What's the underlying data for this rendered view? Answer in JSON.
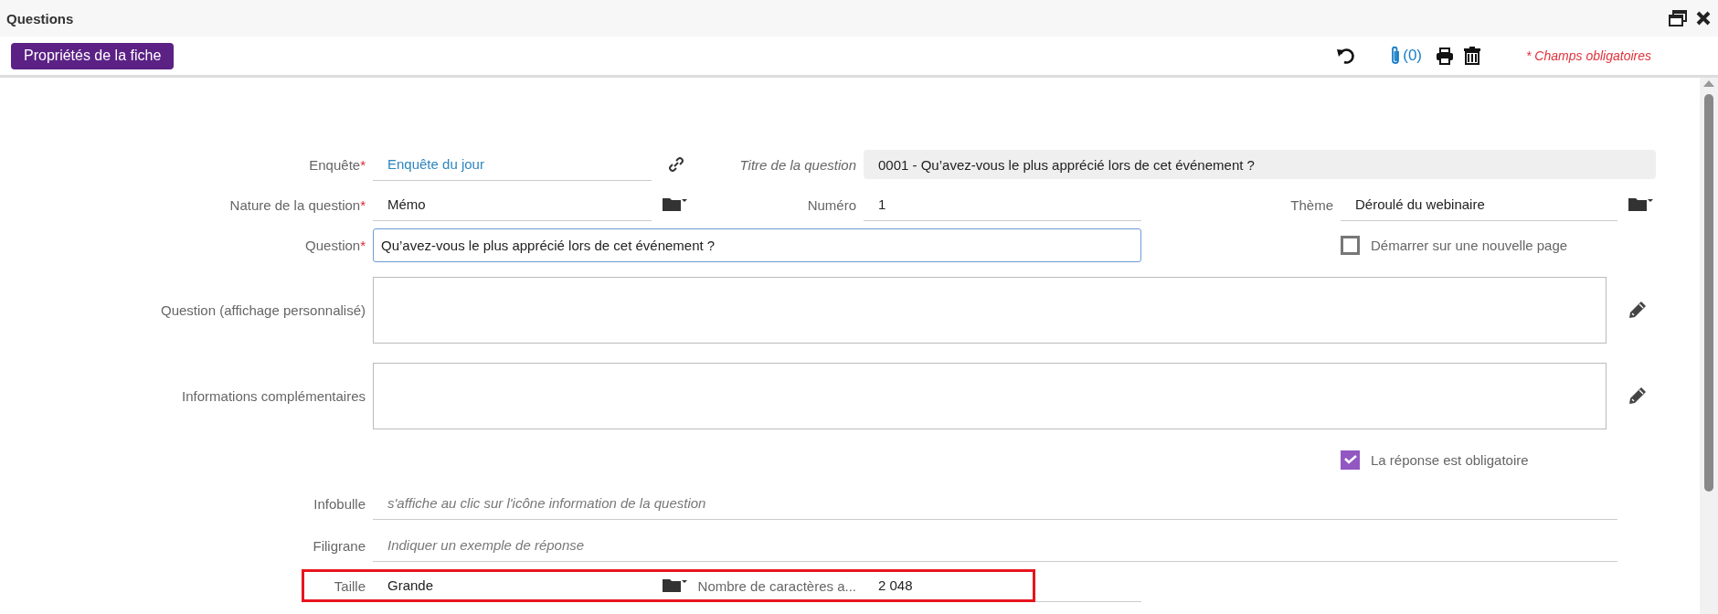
{
  "window": {
    "title": "Questions"
  },
  "toolbar": {
    "properties_button": "Propriétés de la fiche",
    "attachments_count": "(0)",
    "required_note": "* Champs obligatoires"
  },
  "form": {
    "survey": {
      "label": "Enquête",
      "required_mark": "*",
      "value": "Enquête du jour"
    },
    "question_title": {
      "label": "Titre de la question",
      "value": "0001 - Qu’avez-vous le plus apprécié lors de cet événement ?"
    },
    "nature": {
      "label": "Nature de la question",
      "required_mark": "*",
      "value": "Mémo"
    },
    "number": {
      "label": "Numéro",
      "value": "1"
    },
    "theme": {
      "label": "Thème",
      "value": "Déroulé du webinaire"
    },
    "question": {
      "label": "Question",
      "required_mark": "*",
      "value": "Qu’avez-vous le plus apprécié lors de cet événement ?",
      "focused": true
    },
    "start_new_page": {
      "label": "Démarrer sur une nouvelle page",
      "checked": false
    },
    "custom_display": {
      "label": "Question (affichage personnalisé)"
    },
    "additional_info": {
      "label": "Informations complémentaires"
    },
    "answer_required": {
      "label": "La réponse est obligatoire",
      "checked": true
    },
    "tooltip": {
      "label": "Infobulle",
      "placeholder": "s'affiche au clic sur l'icône information de la question"
    },
    "watermark": {
      "label": "Filigrane",
      "placeholder": "Indiquer un exemple de réponse"
    },
    "size": {
      "label": "Taille",
      "value": "Grande",
      "highlighted": true
    },
    "max_chars": {
      "label": "Nombre de caractères a...",
      "value": "2 048"
    }
  }
}
